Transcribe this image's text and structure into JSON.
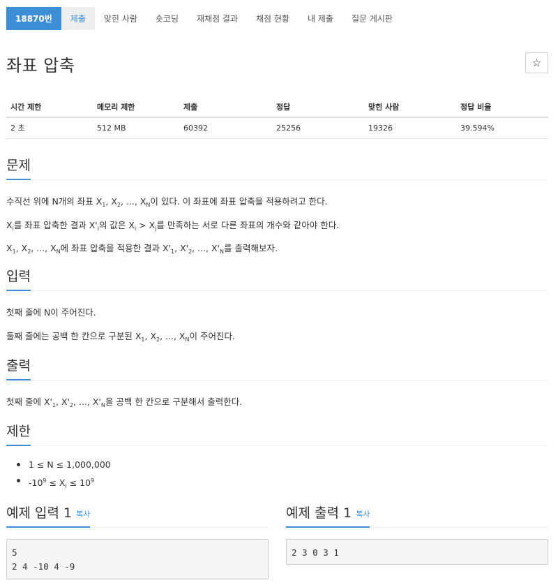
{
  "nav": {
    "problem_number": "18870번",
    "tabs": [
      "제출",
      "맞힌 사람",
      "숏코딩",
      "재채점 결과",
      "채점 현황",
      "내 제출",
      "질문 게시판"
    ]
  },
  "problem": {
    "title": "좌표 압축",
    "star": "☆"
  },
  "info_table": {
    "headers": [
      "시간 제한",
      "메모리 제한",
      "제출",
      "정답",
      "맞힌 사람",
      "정답 비율"
    ],
    "values": [
      "2 초",
      "512 MB",
      "60392",
      "25256",
      "19326",
      "39.594%"
    ]
  },
  "sections": {
    "description": "문제",
    "input": "입력",
    "output": "출력",
    "limit": "제한",
    "sample_input": "예제 입력 1",
    "sample_output": "예제 출력 1",
    "copy": "복사"
  },
  "description": {
    "p1_a": "수직선 위에 N개의 좌표 X",
    "p1_b": "이 있다. 이 좌표에 좌표 압축을 적용하려고 한다.",
    "p2_a": "를 좌표 압축한 결과 X'",
    "p2_b": "의 값은 X",
    "p2_c": "를 만족하는 서로 다른 좌표의 개수와 같아야 한다.",
    "p3_a": "에 좌표 압축을 적용한 결과 X'",
    "p3_b": "를 출력해보자."
  },
  "input": {
    "p1": "첫째 줄에 N이 주어진다.",
    "p2_a": "둘째 줄에는 공백 한 칸으로 구분된 X",
    "p2_b": "이 주어진다."
  },
  "output": {
    "p1_a": "첫째 줄에 X'",
    "p1_b": "을 공백 한 칸으로 구분해서 출력한다."
  },
  "limits": {
    "l1": "1 ≤ N ≤ 1,000,000",
    "l2_a": "-10",
    "l2_b": " ≤ X",
    "l2_c": " ≤ 10"
  },
  "samples": {
    "input": "5\n2 4 -10 4 -9",
    "output": "2 3 0 3 1"
  }
}
